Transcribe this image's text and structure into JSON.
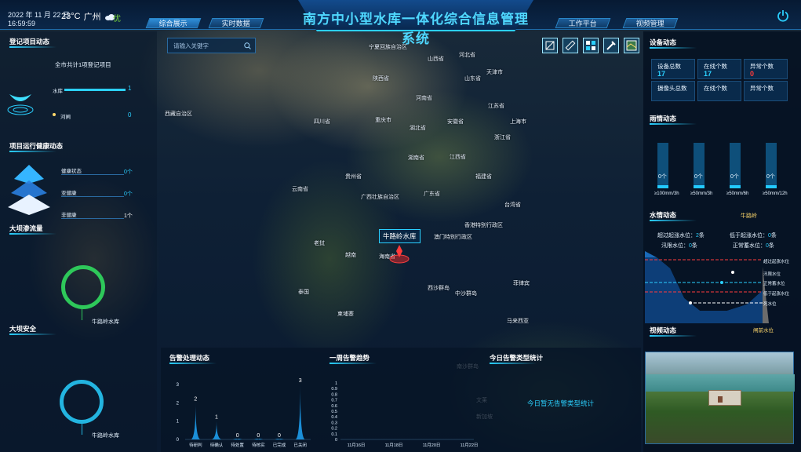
{
  "header": {
    "date": "2022 年 11 月 22 日",
    "time": "16:59:59",
    "temperature": "23°C",
    "city": "广州",
    "weather_icon": "cloud-icon",
    "air_quality": "优",
    "title": "南方中小型水库一体化综合信息管理系统",
    "nav_left": [
      "综合展示",
      "实时数据"
    ],
    "nav_right": [
      "工作平台",
      "视频管理"
    ],
    "active_nav": "综合展示"
  },
  "search": {
    "placeholder": "请输入关键字"
  },
  "left": {
    "registration": {
      "title": "登记项目动态",
      "summary": "全市共计1项登记项目",
      "items": [
        {
          "label": "水库",
          "value": "1"
        },
        {
          "label": "河闸",
          "value": "0"
        }
      ]
    },
    "health": {
      "title": "项目运行健康动态",
      "items": [
        {
          "label": "健康状态",
          "value": "0个"
        },
        {
          "label": "亚健康",
          "value": "0个"
        },
        {
          "label": "非健康",
          "value": "1个"
        }
      ]
    },
    "seepage": {
      "title": "大坝渗流量",
      "reservoir": "牛路岭水库"
    },
    "safety": {
      "title": "大坝安全",
      "reservoir": "牛路岭水库"
    }
  },
  "map": {
    "labels": [
      "宁夏回族自治区",
      "山西省",
      "河北省",
      "天津市",
      "山东省",
      "西藏自治区",
      "陕西省",
      "河南省",
      "江苏省",
      "安徽省",
      "四川省",
      "重庆市",
      "湖北省",
      "上海市",
      "浙江省",
      "湖南省",
      "江西省",
      "贵州省",
      "福建省",
      "台湾省",
      "云南省",
      "广西壮族自治区",
      "广东省",
      "香港特别行政区",
      "澳门特别行政区",
      "海南省",
      "老挝",
      "越南",
      "泰国",
      "柬埔寨",
      "菲律宾",
      "西沙群岛",
      "中沙群岛",
      "南沙群岛",
      "马来西亚",
      "文莱",
      "新加坡"
    ],
    "highlight_label": "牛路岭水库"
  },
  "toolbar": {
    "buttons": [
      "draw-rect-icon",
      "measure-icon",
      "layers-icon",
      "tools-icon",
      "map-mode-icon"
    ]
  },
  "right": {
    "device": {
      "title": "设备动态",
      "cells": [
        {
          "label": "设备总数",
          "value": "17"
        },
        {
          "label": "在线个数",
          "value": "17"
        },
        {
          "label": "异常个数",
          "value": "0"
        },
        {
          "label": "摄像头总数",
          "value": ""
        },
        {
          "label": "在线个数",
          "value": ""
        },
        {
          "label": "异常个数",
          "value": ""
        }
      ]
    },
    "rain": {
      "title": "雨情动态",
      "bars": [
        {
          "label": "≥100mm/3h",
          "value": "0个",
          "fraction": 0.05
        },
        {
          "label": "≥50mm/3h",
          "value": "0个",
          "fraction": 0.05
        },
        {
          "label": "≥50mm/6h",
          "value": "0个",
          "fraction": 0.05
        },
        {
          "label": "≥50mm/12h",
          "value": "0个",
          "fraction": 0.05
        }
      ]
    },
    "water": {
      "title": "水情动态",
      "reservoir": "牛路岭",
      "stats": [
        {
          "label": "超过起涨水位",
          "value": "2",
          "unit": "条"
        },
        {
          "label": "低于起涨水位",
          "value": "0",
          "unit": "条"
        },
        {
          "label": "汛限水位",
          "value": "0",
          "unit": "条"
        },
        {
          "label": "正常蓄水位",
          "value": "0",
          "unit": "条"
        }
      ],
      "legend": [
        "超过起涨水位",
        "汛限水位",
        "正常蓄水位",
        "低于起涨水位",
        "死水位"
      ],
      "right_label": "闸前水位"
    },
    "video": {
      "title": "视频动态"
    }
  },
  "bottom": {
    "alarm": {
      "title": "告警处理动态",
      "chart_data": {
        "type": "bar",
        "categories": [
          "待研判",
          "待确认",
          "待处置",
          "待核实",
          "已完成",
          "已关闭"
        ],
        "values": [
          2,
          1,
          0,
          0,
          0,
          3
        ],
        "ylim": [
          0,
          3
        ],
        "yticks": [
          "0",
          "1",
          "2",
          "3"
        ]
      }
    },
    "trend": {
      "title": "一周告警趋势",
      "chart_data": {
        "type": "line",
        "x": [
          "11月16日",
          "11月18日",
          "11月20日",
          "11月22日"
        ],
        "ylim": [
          0,
          1
        ],
        "yticks": [
          "0",
          "0.1",
          "0.2",
          "0.3",
          "0.4",
          "0.5",
          "0.6",
          "0.7",
          "0.8",
          "0.9",
          "1"
        ]
      }
    },
    "today": {
      "title": "今日告警类型统计",
      "empty_text": "今日暂无告警类型统计"
    }
  },
  "colors": {
    "accent": "#2bd0ff",
    "title": "#4fd8ff",
    "good": "#7cdc3c",
    "alert": "#ff3b3b",
    "ring_green": "#2ec85a",
    "ring_blue": "#23b4e0"
  }
}
